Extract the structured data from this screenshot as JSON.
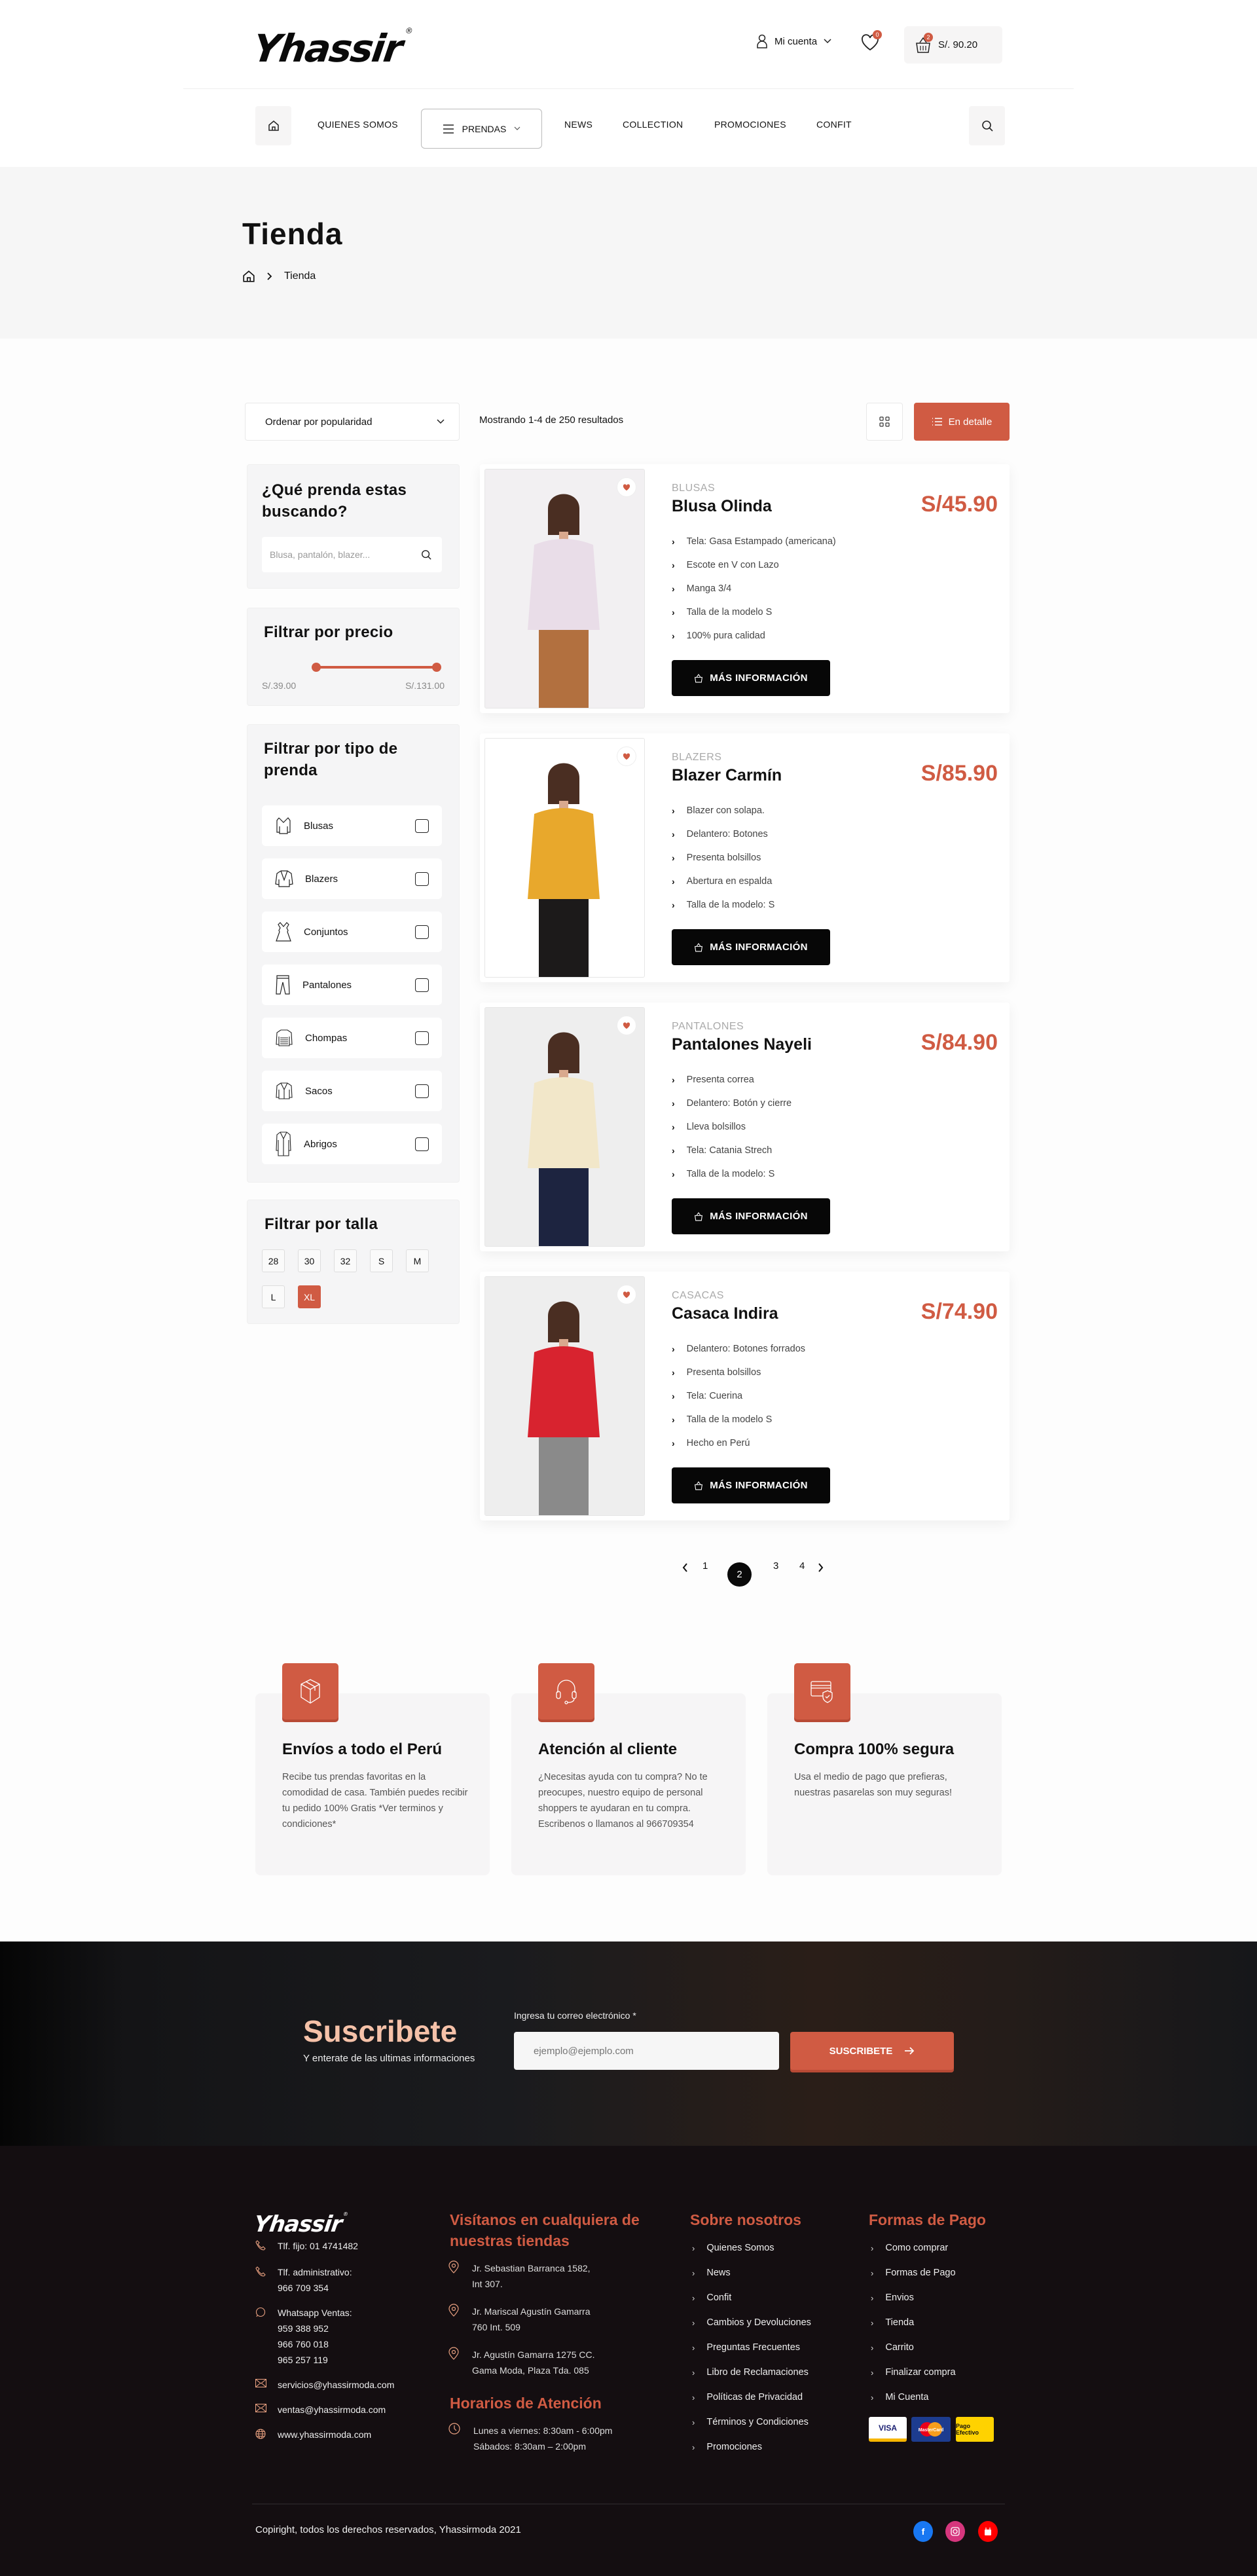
{
  "header": {
    "logo": "Yhassir",
    "logo_mark": "®",
    "account_label": "Mi cuenta",
    "wishlist_count": "0",
    "cart_count": "2",
    "cart_total": "S/. 90.20"
  },
  "nav": {
    "items": [
      "QUIENES SOMOS",
      "PRENDAS",
      "NEWS",
      "COLLECTION",
      "PROMOCIONES",
      "CONFIT"
    ]
  },
  "hero": {
    "title": "Tienda",
    "breadcrumb_current": "Tienda"
  },
  "toolbar": {
    "sort_selected": "Ordenar por popularidad",
    "showing": "Mostrando 1-4 de 250 resultados",
    "detail_view_label": "En detalle"
  },
  "sidebar": {
    "search_title": "¿Qué prenda estas buscando?",
    "search_placeholder": "Blusa, pantalón, blazer...",
    "price_title": "Filtrar por precio",
    "price_min": "S/.39.00",
    "price_max": "S/.131.00",
    "type_title": "Filtrar por tipo de prenda",
    "types": [
      "Blusas",
      "Blazers",
      "Conjuntos",
      "Pantalones",
      "Chompas",
      "Sacos",
      "Abrigos"
    ],
    "size_title": "Filtrar por talla",
    "sizes": [
      "28",
      "30",
      "32",
      "S",
      "M",
      "L",
      "XL"
    ],
    "size_selected": "XL"
  },
  "products": [
    {
      "category": "BLUSAS",
      "name": "Blusa Olinda",
      "price": "S/45.90",
      "features": [
        "Tela: Gasa Estampado (americana)",
        "Escote en V con Lazo",
        "Manga 3/4",
        "Talla de la modelo  S",
        "100% pura calidad"
      ],
      "button": "MÁS INFORMACIÓN",
      "image_colors": [
        "#f2f0f2",
        "#e9dde8",
        "#b2703f"
      ]
    },
    {
      "category": "BLAZERS",
      "name": "Blazer Carmín",
      "price": "S/85.90",
      "features": [
        "Blazer con solapa.",
        "Delantero: Botones",
        "Presenta bolsillos",
        "Abertura en espalda",
        "Talla de la modelo: S"
      ],
      "button": "MÁS INFORMACIÓN",
      "image_colors": [
        "#ffffff",
        "#e8a82c",
        "#1c1a1a"
      ]
    },
    {
      "category": "PANTALONES",
      "name": "Pantalones Nayeli",
      "price": "S/84.90",
      "features": [
        "Presenta correa",
        "Delantero: Botón y cierre",
        "Lleva bolsillos",
        "Tela: Catania Strech",
        "Talla de la modelo: S"
      ],
      "button": "MÁS INFORMACIÓN",
      "image_colors": [
        "#eeeeee",
        "#f2e7c9",
        "#1d2440"
      ]
    },
    {
      "category": "CASACAS",
      "name": "Casaca Indira",
      "price": "S/74.90",
      "features": [
        "Delantero: Botones forrados",
        "Presenta bolsillos",
        "Tela: Cuerina",
        "Talla de la modelo  S",
        "Hecho en Perú"
      ],
      "button": "MÁS INFORMACIÓN",
      "image_colors": [
        "#eeeeee",
        "#d8232f",
        "#8a8a8a"
      ]
    }
  ],
  "pagination": {
    "pages": [
      "1",
      "2",
      "3",
      "4"
    ],
    "current": "2"
  },
  "features": [
    {
      "title": "Envíos a todo el Perú",
      "text": "Recibe tus prendas favoritas en la comodidad de casa. También puedes recibir tu pedido 100% Gratis *Ver terminos y condiciones*"
    },
    {
      "title": "Atención al cliente",
      "text": "¿Necesitas ayuda con tu compra? No te preocupes, nuestro equipo de personal shoppers te ayudaran en tu compra. Escribenos o llamanos al 966709354"
    },
    {
      "title": "Compra 100% segura",
      "text": "Usa el medio de pago que prefieras, nuestras pasarelas son muy seguras!"
    }
  ],
  "subscribe": {
    "title": "Suscribete",
    "subtitle": "Y enterate de las ultimas informaciones",
    "field_label": "Ingresa tu correo electrónico *",
    "placeholder": "ejemplo@ejemplo.com",
    "button": "SUSCRIBETE"
  },
  "footer": {
    "logo": "Yhassir",
    "contacts": [
      {
        "icon": "phone",
        "lines": [
          "Tlf. fijo: 01 4741482"
        ]
      },
      {
        "icon": "phone",
        "lines": [
          "Tlf. administrativo:",
          "966 709 354"
        ]
      },
      {
        "icon": "whatsapp",
        "lines": [
          "Whatsapp Ventas:",
          "959 388 952",
          "966 760 018",
          "965 257 119"
        ]
      },
      {
        "icon": "mail",
        "lines": [
          "servicios@yhassirmoda.com"
        ]
      },
      {
        "icon": "mail",
        "lines": [
          "ventas@yhassirmoda.com"
        ]
      },
      {
        "icon": "globe",
        "lines": [
          "www.yhassirmoda.com"
        ]
      }
    ],
    "stores_title": "Visítanos en cualquiera de nuestras tiendas",
    "stores": [
      [
        "Jr. Sebastian Barranca 1582,",
        "Int 307."
      ],
      [
        "Jr. Mariscal Agustín Gamarra",
        "760 Int. 509"
      ],
      [
        "Jr. Agustín Gamarra 1275 CC.",
        "Gama Moda, Plaza Tda. 085"
      ]
    ],
    "hours_title": "Horarios de Atención",
    "hours": [
      "Lunes a viernes: 8:30am - 6:00pm",
      "Sábados: 8:30am – 2:00pm"
    ],
    "about_title": "Sobre nosotros",
    "about_links": [
      "Quienes Somos",
      "News",
      "Confit",
      "Cambios y Devoluciones",
      "Preguntas Frecuentes",
      "Libro de Reclamaciones",
      "Políticas de Privacidad",
      "Términos y Condiciones",
      "Promociones"
    ],
    "pay_title": "Formas de Pago",
    "pay_links": [
      "Como comprar",
      "Formas de Pago",
      "Envios",
      "Tienda",
      "Carrito",
      "Finalizar compra",
      "Mi Cuenta"
    ],
    "pay_methods": [
      "VISA",
      "MasterCard",
      "Pago Efectivo"
    ],
    "copyright": "Copiright, todos los derechos reservados, Yhassirmoda 2021",
    "social": [
      "facebook",
      "instagram",
      "youtube"
    ]
  },
  "colors": {
    "accent": "#d05b43",
    "dark": "#140e11",
    "light_bg": "#f6f6f6"
  }
}
